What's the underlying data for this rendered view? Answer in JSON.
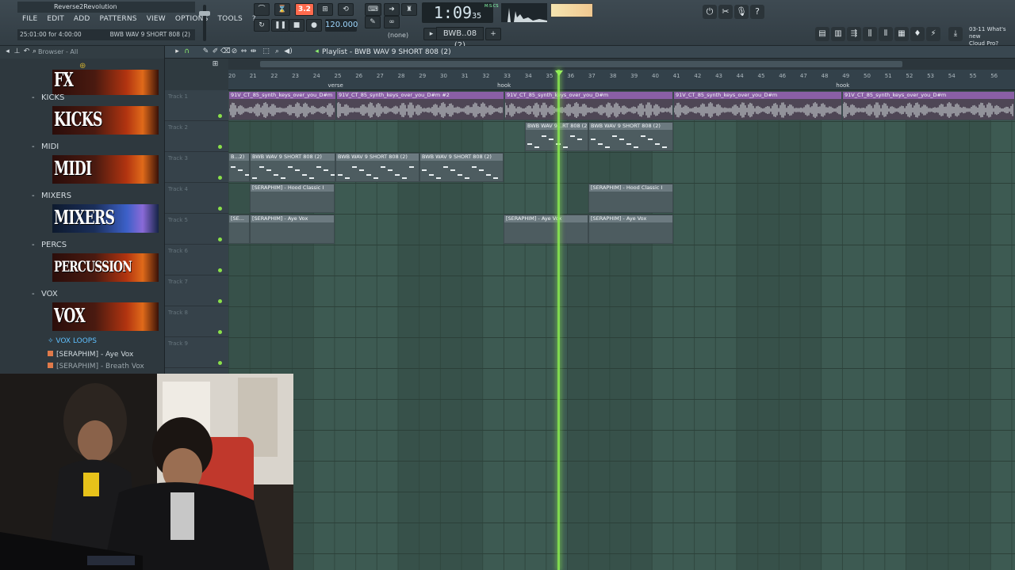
{
  "window": {
    "title": "Reverse2Revolution",
    "hint": "25:01:00 for 4:00:00",
    "hint_right": "BWB WAV 9 SHORT 808 (2)"
  },
  "menu": [
    "FILE",
    "EDIT",
    "ADD",
    "PATTERNS",
    "VIEW",
    "OPTIONS",
    "TOOLS",
    "?"
  ],
  "transport": {
    "pat_song": "3.2",
    "tempo": "120.000",
    "time_main": "1:09",
    "time_sub": "35",
    "time_unit": "M:S:CS",
    "pattern_selector": "BWB..08 (2)",
    "snap": "(none)"
  },
  "news": {
    "line1": "03-11  What's new",
    "line2": "Cloud Pro?"
  },
  "browser": {
    "header": "Browser - All",
    "categories": [
      {
        "label": "",
        "banner": "FX",
        "color": "red"
      },
      {
        "label": "KICKS",
        "banner": "KICKS",
        "color": "red"
      },
      {
        "label": "MIDI",
        "banner": "MIDI",
        "color": "red"
      },
      {
        "label": "MIXERS",
        "banner": "MIXERS",
        "color": "blue"
      },
      {
        "label": "PERCS",
        "banner": "PERCUSSION",
        "color": "red"
      },
      {
        "label": "VOX",
        "banner": "VOX",
        "color": "red"
      }
    ],
    "selected_folder": "VOX LOOPS",
    "files": [
      "[SERAPHIM] - Aye Vox",
      "[SERAPHIM] - Breath Vox"
    ]
  },
  "playlist": {
    "title": "Playlist - BWB WAV 9 SHORT 808 (2)",
    "bars": [
      "20",
      "21",
      "22",
      "23",
      "24",
      "25",
      "26",
      "27",
      "28",
      "29",
      "30",
      "31",
      "32",
      "33",
      "34",
      "35",
      "36",
      "37",
      "38",
      "39",
      "40",
      "41",
      "42",
      "43",
      "44",
      "45",
      "46",
      "47",
      "48",
      "49",
      "50",
      "51",
      "52",
      "53",
      "54",
      "55",
      "56"
    ],
    "markers": [
      {
        "label": "verse",
        "bar": 25
      },
      {
        "label": "hook",
        "bar": 33
      },
      {
        "label": "hook",
        "bar": 49
      }
    ],
    "tracks": [
      "Track 1",
      "Track 2",
      "Track 3",
      "Track 4",
      "Track 5",
      "Track 6",
      "Track 7",
      "Track 8",
      "Track 9"
    ],
    "clips": {
      "t1_a": "91V_CT_85_synth_keys_over_you_D#m",
      "t1_b": "91V_CT_85_synth_keys_over_you_D#m #2",
      "t1_c": "91V_CT_85_synth_keys_over_you_D#m",
      "t1_d": "91V_CT_85_synth_keys_over_you_D#m",
      "t1_e": "91V_CT_85_synth_keys_over_you_D#m",
      "t2_a": "BWB WAV 9...RT 808 (2)",
      "t2_b": "BWB WAV 9 SHORT 808 (2)",
      "t3_a": "B...2)",
      "t3_b": "BWB WAV 9 SHORT 808 (2)",
      "t3_c": "BWB WAV 9 SHORT 808 (2)",
      "t3_d": "BWB WAV 9 SHORT 808 (2)",
      "t4_a": "[SERAPHIM] - Hood Classic I",
      "t4_b": "[SERAPHIM] - Hood Classic I",
      "t5_a": "[SE...",
      "t5_b": "[SERAPHIM] - Aye Vox",
      "t5_c": "[SERAPHIM] - Aye Vox",
      "t5_d": "[SERAPHIM] - Aye Vox"
    }
  },
  "colors": {
    "accent": "#ff6a4d",
    "playhead": "#8cf050",
    "grid": "#3d5a52",
    "selected": "#5fc0ff"
  }
}
